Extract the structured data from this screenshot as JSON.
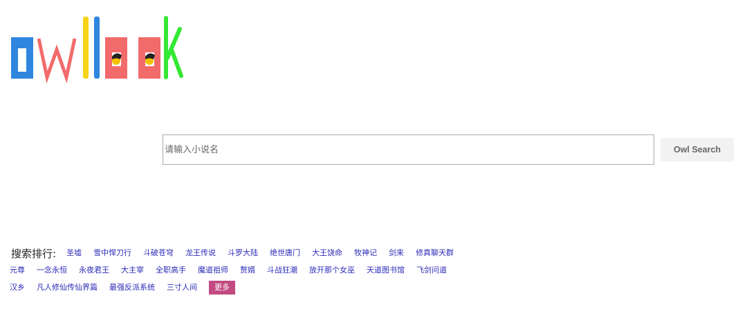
{
  "logo": {
    "text": "owllook",
    "colors": [
      "#2e86de",
      "#f26b6b",
      "#f7d417",
      "#2e86de",
      "#f26b6b",
      "#f26b6b",
      "#33e833"
    ]
  },
  "search": {
    "placeholder": "请输入小说名",
    "button_label": "Owl Search"
  },
  "ranking": {
    "title": "搜索排行:",
    "rows": [
      [
        "圣墟",
        "雪中悍刀行",
        "斗破苍穹",
        "龙王传说",
        "斗罗大陆",
        "绝世唐门",
        "大王饶命",
        "牧神记",
        "剑来",
        "修真聊天群"
      ],
      [
        "元尊",
        "一念永恒",
        "永夜君王",
        "大主宰",
        "全职高手",
        "魔道祖师",
        "赘婿",
        "斗战狂潮",
        "放开那个女巫",
        "天道图书馆",
        "飞剑问道"
      ],
      [
        "汉乡",
        "凡人修仙传仙界篇",
        "最强反派系统",
        "三寸人间"
      ]
    ],
    "more_label": "更多"
  }
}
